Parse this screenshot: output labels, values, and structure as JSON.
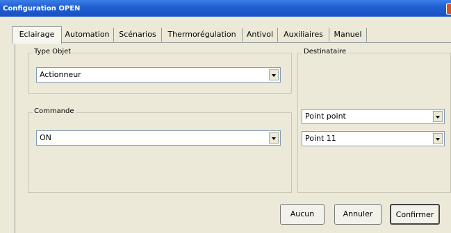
{
  "window": {
    "title": "Configuration OPEN"
  },
  "tabs": [
    {
      "label": "Eclairage"
    },
    {
      "label": "Automation"
    },
    {
      "label": "Scénarios"
    },
    {
      "label": "Thermorégulation"
    },
    {
      "label": "Antivol"
    },
    {
      "label": "Auxiliaires"
    },
    {
      "label": "Manuel"
    }
  ],
  "type_objet": {
    "legend": "Type Objet",
    "value": "Actionneur"
  },
  "commande": {
    "legend": "Commande",
    "value": "ON"
  },
  "destinataire": {
    "legend": "Destinataire",
    "mode_value": "Point point",
    "point_value": "Point 11"
  },
  "buttons": {
    "aucun": "Aucun",
    "annuler": "Annuler",
    "confirmer": "Confirmer"
  }
}
